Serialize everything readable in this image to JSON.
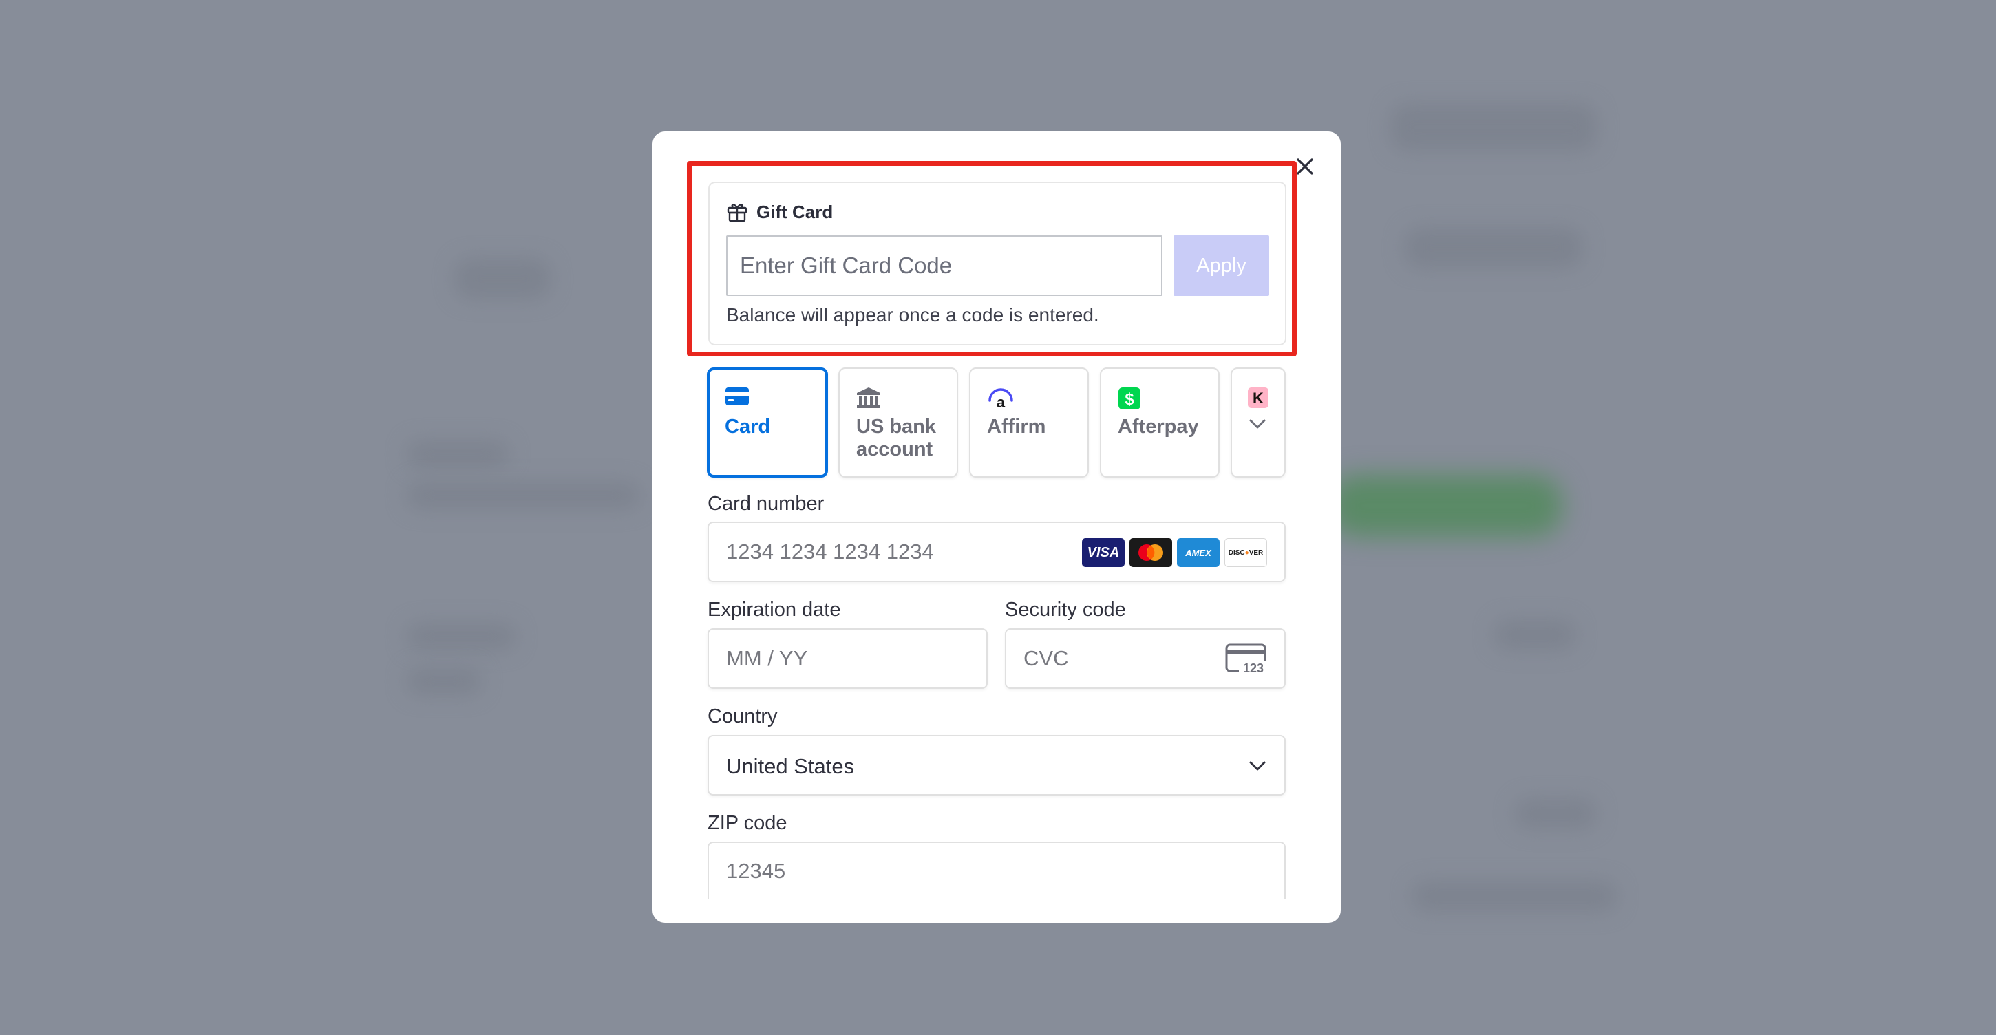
{
  "modal": {
    "close_label": "Close"
  },
  "gift_card": {
    "title": "Gift Card",
    "input_placeholder": "Enter Gift Card Code",
    "apply_label": "Apply",
    "hint": "Balance will appear once a code is entered."
  },
  "payment_tabs": [
    {
      "label": "Card",
      "icon": "card-icon",
      "selected": true
    },
    {
      "label": "US bank account",
      "icon": "bank-icon",
      "selected": false
    },
    {
      "label": "Affirm",
      "icon": "affirm-icon",
      "selected": false
    },
    {
      "label": "Afterpay",
      "icon": "afterpay-icon",
      "selected": false
    },
    {
      "label": "",
      "icon": "klarna-icon",
      "selected": false
    }
  ],
  "card_form": {
    "card_number_label": "Card number",
    "card_number_placeholder": "1234 1234 1234 1234",
    "brands": [
      "VISA",
      "Mastercard",
      "AMEX",
      "DISCOVER"
    ],
    "expiration_label": "Expiration date",
    "expiration_placeholder": "MM / YY",
    "security_label": "Security code",
    "security_placeholder": "CVC",
    "cvc_icon_text": "123",
    "country_label": "Country",
    "country_value": "United States",
    "zip_label": "ZIP code",
    "zip_placeholder": "12345"
  },
  "colors": {
    "accent": "#0570de",
    "highlight": "#e8261e",
    "apply_disabled": "#c9ccf7",
    "backdrop": "#878d99"
  }
}
